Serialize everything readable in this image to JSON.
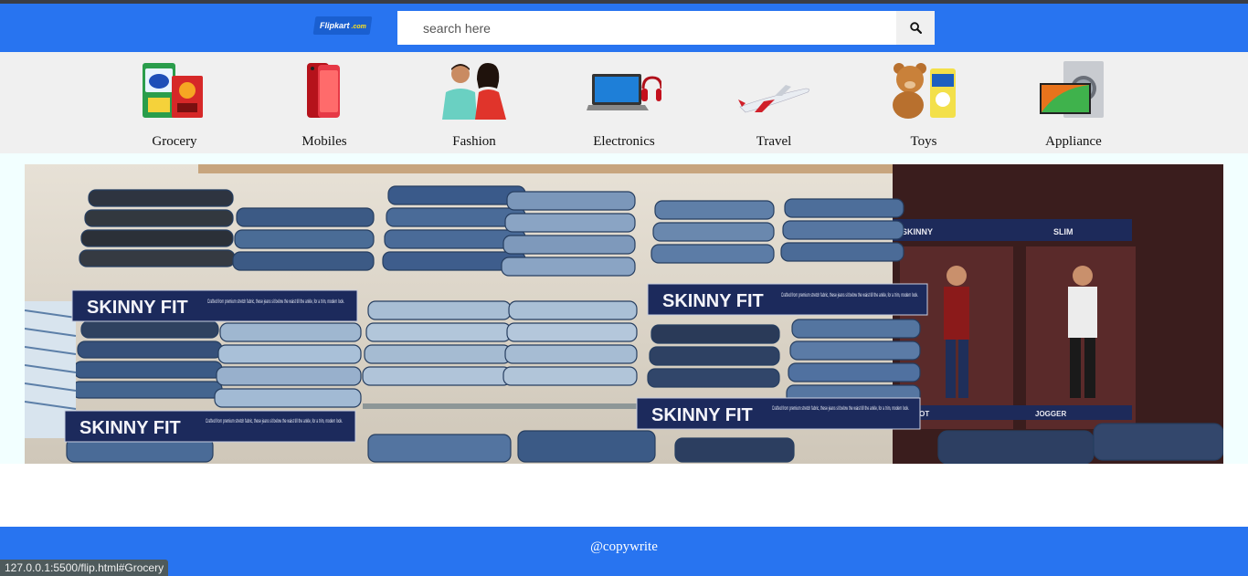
{
  "header": {
    "logo_text": "Flipkart",
    "logo_suffix": ".com",
    "search": {
      "placeholder": "search here",
      "value": ""
    },
    "search_icon": "search-icon"
  },
  "categories": [
    {
      "label": "Grocery",
      "icon": "grocery-image"
    },
    {
      "label": "Mobiles",
      "icon": "mobiles-image"
    },
    {
      "label": "Fashion",
      "icon": "fashion-image"
    },
    {
      "label": "Electronics",
      "icon": "electronics-image"
    },
    {
      "label": "Travel",
      "icon": "travel-image"
    },
    {
      "label": "Toys",
      "icon": "toys-image"
    },
    {
      "label": "Appliance",
      "icon": "appliance-image"
    }
  ],
  "banner": {
    "signs": [
      "SKINNY FIT",
      "SKINNY FIT",
      "SKINNY FIT",
      "SKINNY FIT"
    ],
    "sign_caption": "Crafted from premium stretch fabric, these jeans sit below the waist till the ankle, for a trim, modern look.",
    "poster_labels": [
      "SKINNY",
      "SLIM",
      "CARROT",
      "JOGGER"
    ]
  },
  "footer": {
    "text": "@copywrite"
  },
  "status_bar": {
    "url": "127.0.0.1:5500/flip.html#Grocery"
  },
  "colors": {
    "brand_blue": "#2874f0",
    "category_bg": "#f0f0f0",
    "banner_bg": "#f2ffff"
  }
}
